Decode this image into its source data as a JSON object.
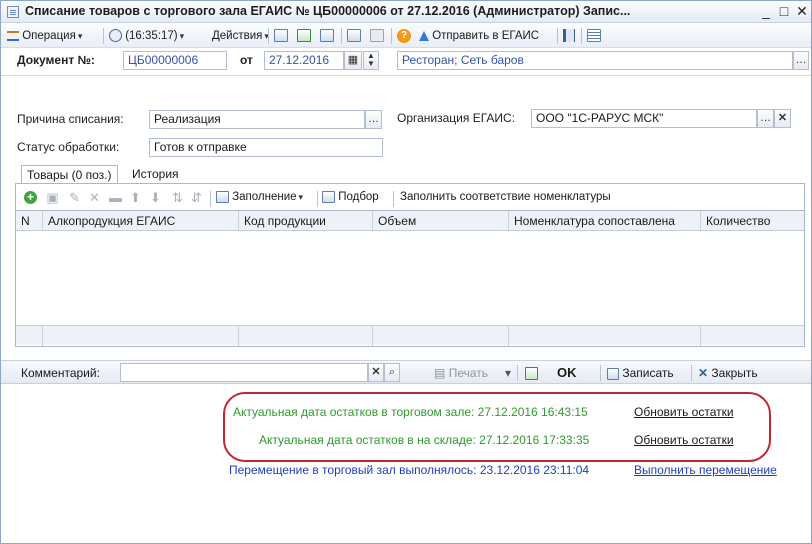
{
  "window": {
    "title": "Списание товаров с торгового зала ЕГАИС № ЦБ00000006 от 27.12.2016 (Администратор) Запис...",
    "minimize": "_",
    "maximize": "□",
    "close": "✕"
  },
  "toolbar": {
    "operation": "Операция",
    "time": "(16:35:17)",
    "actions": "Действия",
    "send_egais": "Отправить в ЕГАИС"
  },
  "document": {
    "number_label": "Документ №:",
    "number": "ЦБ00000006",
    "date_label": "от",
    "date": "27.12.2016",
    "location": "Ресторан; Сеть баров"
  },
  "form": {
    "reason_label": "Причина списания:",
    "reason": "Реализация",
    "org_label": "Организация ЕГАИС:",
    "org": "ООО \"1С-РАРУС МСК\"",
    "status_label": "Статус обработки:",
    "status": "Готов к отправке"
  },
  "tabs": [
    {
      "label": "Товары (0 поз.)"
    },
    {
      "label": "История"
    }
  ],
  "grid_toolbar": {
    "fill": "Заполнение",
    "select": "Подбор",
    "match": "Заполнить соответствие номенклатуры"
  },
  "table": {
    "columns": [
      "N",
      "Алкопродукция ЕГАИС",
      "Код продукции",
      "Объем",
      "Номенклатура сопоставлена",
      "Количество"
    ]
  },
  "bottom": {
    "comment_label": "Комментарий:",
    "comment": "",
    "print": "Печать",
    "ok": "OK",
    "save": "Записать",
    "close": "Закрыть"
  },
  "status": {
    "hall_text": "Актуальная дата остатков в торговом зале: 27.12.2016 16:43:15",
    "hall_link": "Обновить остатки",
    "warehouse_text": "Актуальная дата остатков в на складе: 27.12.2016 17:33:35",
    "warehouse_link": "Обновить остатки",
    "transfer_text": "Перемещение в торговый зал выполнялось: 23.12.2016 23:11:04",
    "transfer_link": "Выполнить перемещение"
  },
  "colors": {
    "highlight_oval": "#c0282e",
    "status_green": "#2d9a2d",
    "status_navy": "#1f3fb8"
  }
}
